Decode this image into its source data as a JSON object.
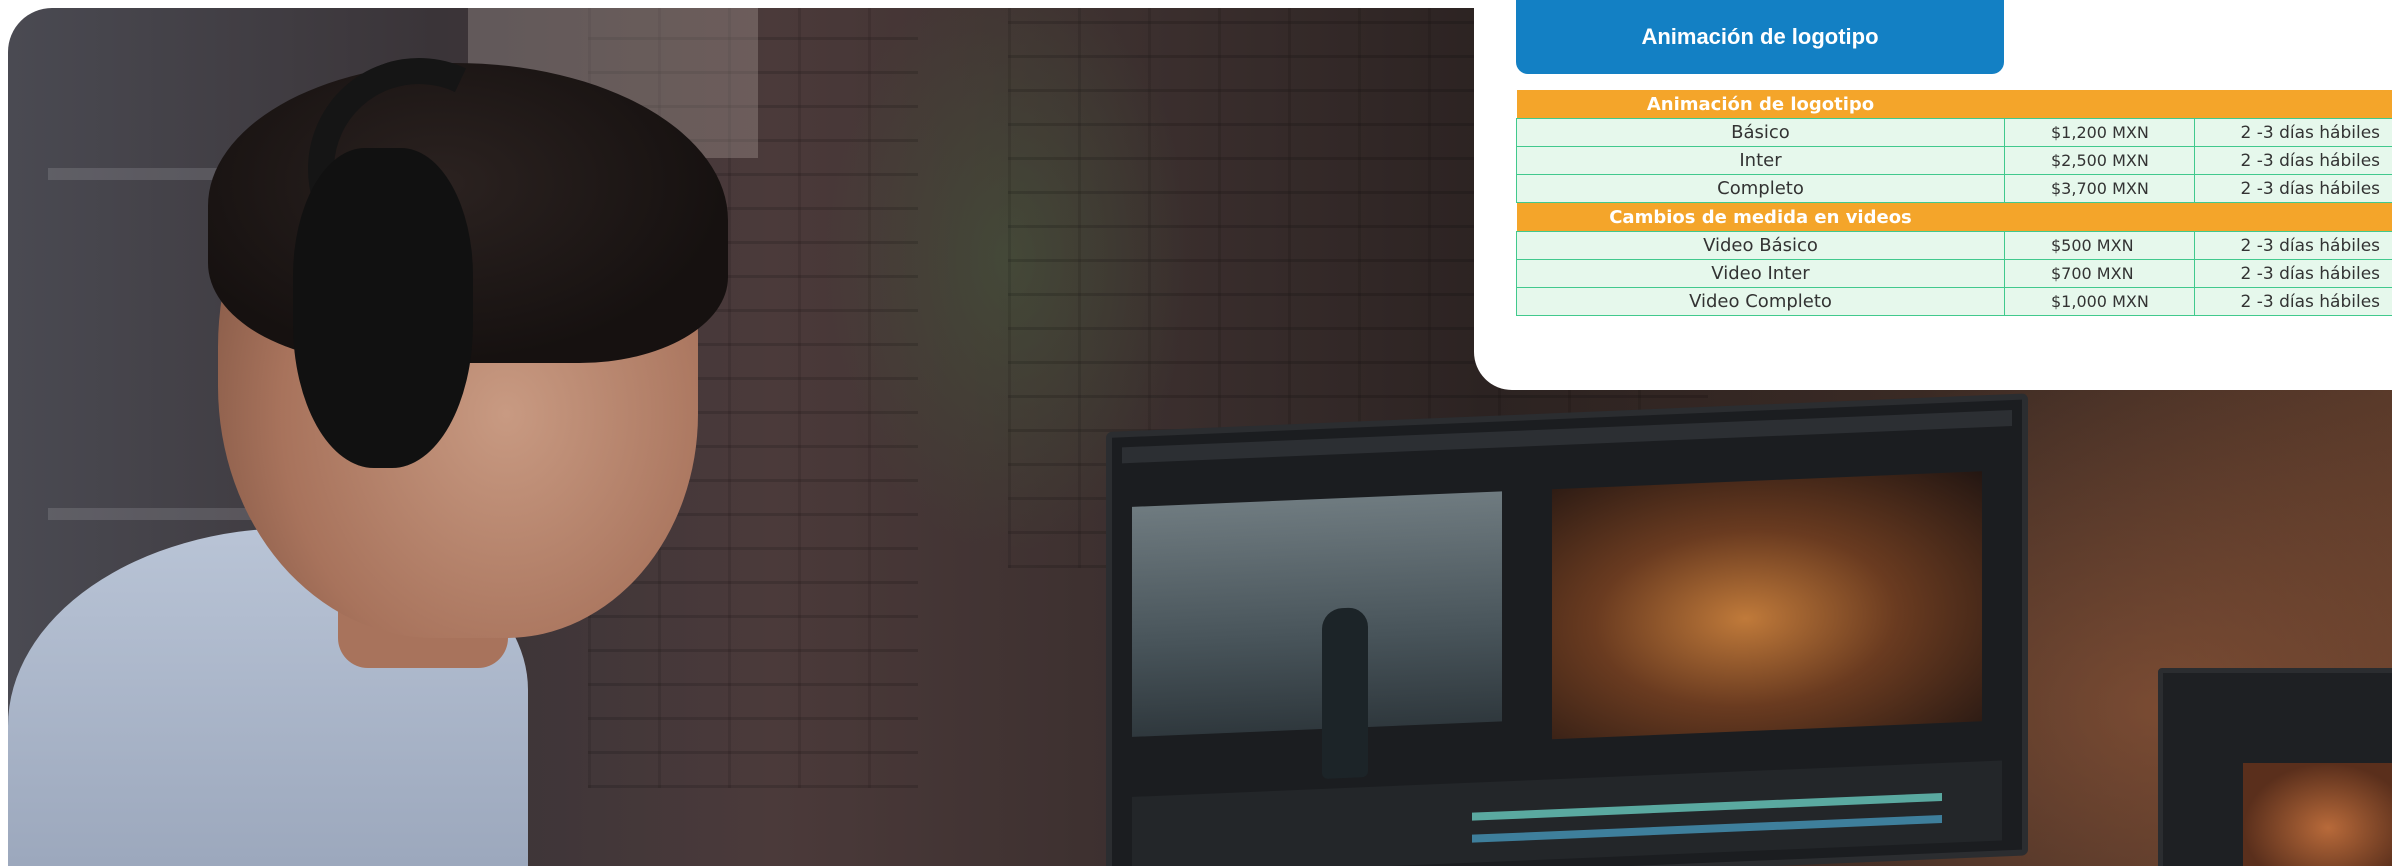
{
  "card": {
    "title": "Animación de logotipo"
  },
  "table": {
    "sections": [
      {
        "label": "Animación de logotipo",
        "rows": [
          {
            "service": "Básico",
            "price": "$1,200  MXN",
            "time": "2 -3 días hábiles"
          },
          {
            "service": "Inter",
            "price": "$2,500 MXN",
            "time": "2 -3 días hábiles"
          },
          {
            "service": "Completo",
            "price": "$3,700 MXN",
            "time": "2 -3 días hábiles"
          }
        ]
      },
      {
        "label": "Cambios de medida en videos",
        "rows": [
          {
            "service": "Video Básico",
            "price": "$500   MXN",
            "time": "2 -3 días hábiles"
          },
          {
            "service": "Video Inter",
            "price": "$700   MXN",
            "time": "2 -3 días hábiles"
          },
          {
            "service": "Video Completo",
            "price": "$1,000 MXN",
            "time": "2 -3 días hábiles"
          }
        ]
      }
    ]
  },
  "colors": {
    "title_bg": "#1380c4",
    "section_bg": "#f4a52a",
    "row_bg": "#e6f8ec",
    "row_border": "#41c98d"
  }
}
